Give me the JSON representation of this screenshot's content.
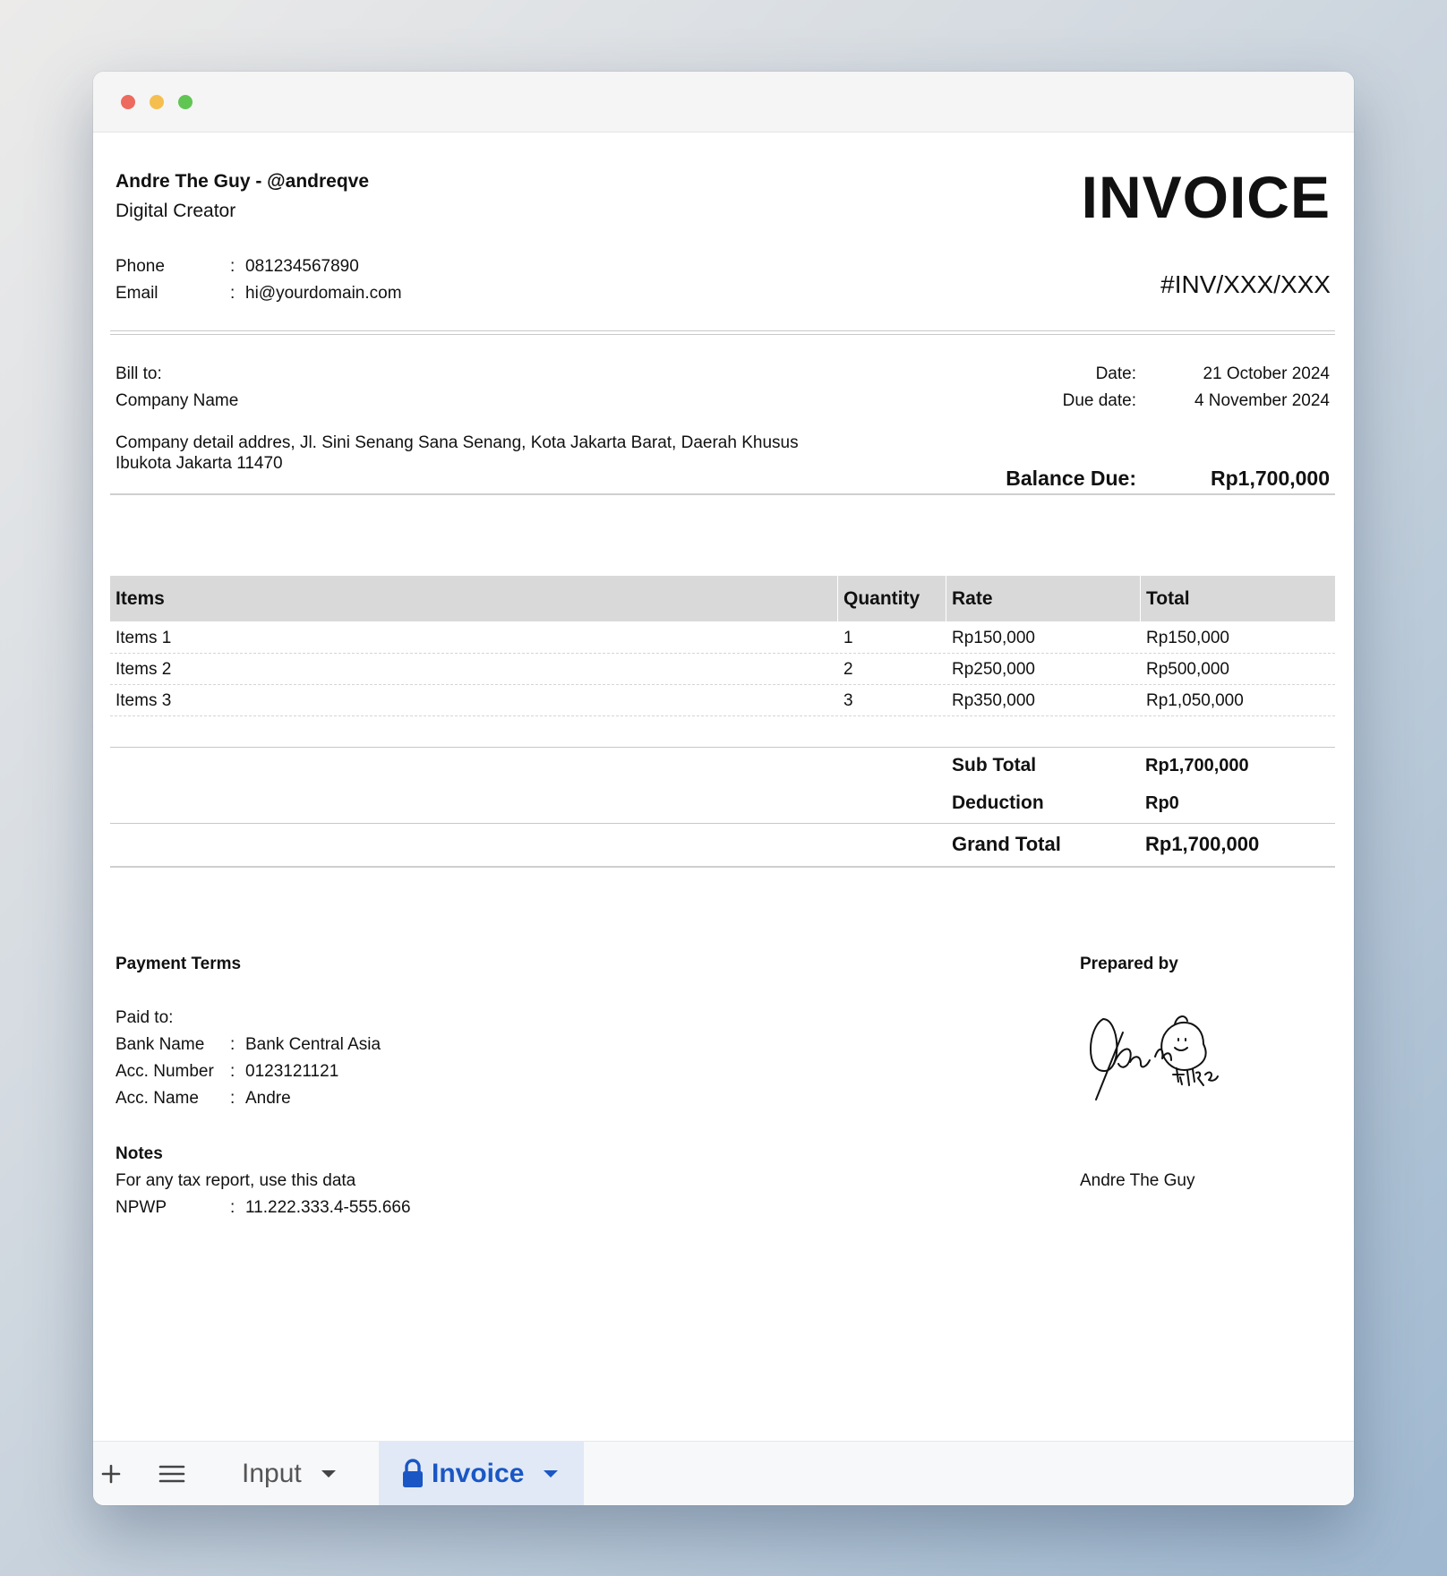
{
  "sender": {
    "name": "Andre The Guy - @andreqve",
    "role": "Digital Creator",
    "contacts": [
      {
        "label": "Phone",
        "value": "081234567890"
      },
      {
        "label": "Email",
        "value": "hi@yourdomain.com"
      }
    ]
  },
  "invoice": {
    "title": "INVOICE",
    "number": "#INV/XXX/XXX"
  },
  "bill": {
    "label": "Bill to:",
    "company": "Company Name",
    "address_line1": "Company detail addres, Jl. Sini Senang Sana Senang, Kota Jakarta Barat, Daerah Khusus",
    "address_line2": "Ibukota Jakarta 11470"
  },
  "dates": {
    "date_label": "Date:",
    "date_value": "21 October 2024",
    "due_label": "Due date:",
    "due_value": "4 November 2024"
  },
  "balance": {
    "label": "Balance Due:",
    "value": "Rp1,700,000"
  },
  "table": {
    "headers": [
      "Items",
      "Quantity",
      "Rate",
      "Total"
    ],
    "rows": [
      [
        "Items 1",
        "1",
        "Rp150,000",
        "Rp150,000"
      ],
      [
        "Items 2",
        "2",
        "Rp250,000",
        "Rp500,000"
      ],
      [
        "Items 3",
        "3",
        "Rp350,000",
        "Rp1,050,000"
      ]
    ]
  },
  "totals": {
    "subtotal_label": "Sub Total",
    "subtotal_value": "Rp1,700,000",
    "deduction_label": "Deduction",
    "deduction_value": "Rp0",
    "grand_label": "Grand Total",
    "grand_value": "Rp1,700,000"
  },
  "payment": {
    "title": "Payment Terms",
    "paid_to": "Paid to:",
    "fields": [
      {
        "label": "Bank Name",
        "value": "Bank Central Asia"
      },
      {
        "label": "Acc. Number",
        "value": "0123121121"
      },
      {
        "label": "Acc. Name",
        "value": "Andre"
      }
    ]
  },
  "notes": {
    "title": "Notes",
    "text": "For any tax report, use this data",
    "npwp_label": "NPWP",
    "npwp_value": "11.222.333.4-555.666"
  },
  "prepared": {
    "title": "Prepared by",
    "name": "Andre The Guy"
  },
  "separator": ":",
  "sheet_tabs": {
    "add_icon": "plus-icon",
    "menu_icon": "hamburger-menu-icon",
    "tabs": [
      {
        "label": "Input",
        "active": false
      },
      {
        "label": "Invoice",
        "active": true,
        "icon": "lock-icon"
      }
    ]
  },
  "colors": {
    "active_tab_bg": "#e1e9f7",
    "active_tab_text": "#1a57c4",
    "table_header_bg": "#d9d9d9"
  }
}
